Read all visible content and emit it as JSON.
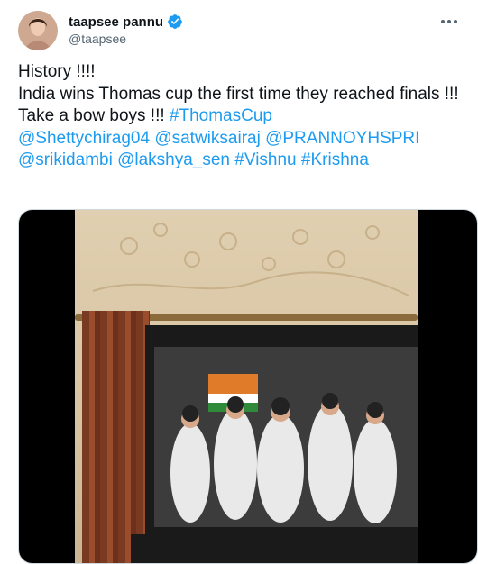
{
  "user": {
    "display_name": "taapsee pannu",
    "handle": "@taapsee"
  },
  "tweet": {
    "lines": [
      [
        {
          "text": "History !!!!",
          "link": false
        }
      ],
      [
        {
          "text": "India wins Thomas cup the first time they reached finals !!!",
          "link": false
        }
      ],
      [
        {
          "text": "Take a bow boys !!! ",
          "link": false
        },
        {
          "text": "#ThomasCup",
          "link": true
        }
      ],
      [
        {
          "text": "@Shettychirag04",
          "link": true
        },
        {
          "text": " ",
          "link": false
        },
        {
          "text": "@satwiksairaj",
          "link": true
        },
        {
          "text": " ",
          "link": false
        },
        {
          "text": "@PRANNOYHSPRI",
          "link": true
        }
      ],
      [
        {
          "text": "@srikidambi",
          "link": true
        },
        {
          "text": " ",
          "link": false
        },
        {
          "text": "@lakshya_sen",
          "link": true
        },
        {
          "text": " ",
          "link": false
        },
        {
          "text": "#Vishnu",
          "link": true
        },
        {
          "text": " ",
          "link": false
        },
        {
          "text": "#Krishna",
          "link": true
        }
      ]
    ]
  },
  "icons": {
    "verified": "verified-badge-icon",
    "more": "more-options-icon"
  },
  "colors": {
    "link": "#1d9bf0",
    "text": "#0f1419",
    "secondary": "#536471"
  }
}
